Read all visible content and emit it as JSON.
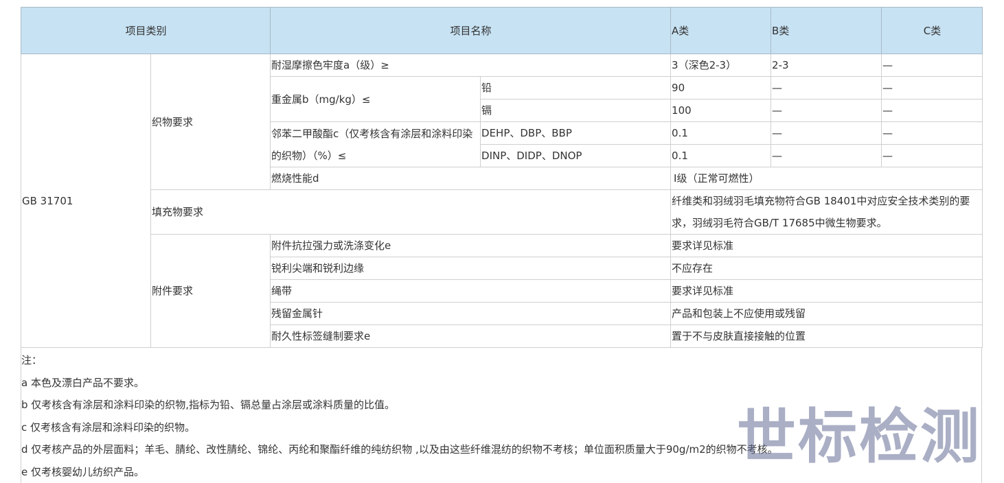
{
  "header": {
    "category": "项目类别",
    "name": "项目名称",
    "class_a": "A类",
    "class_b": "B类",
    "class_c": "C类"
  },
  "standard": "GB 31701",
  "fabric": {
    "label": "织物要求",
    "rub_fastness": {
      "name": "耐湿摩擦色牢度a（级）≥",
      "a": "3（深色2-3）",
      "b": "2-3",
      "c": "—"
    },
    "heavy_metal": {
      "name": "重金属b（mg/kg）≤",
      "lead": {
        "sub": "铅",
        "a": "90",
        "b": "—",
        "c": "—"
      },
      "cadmium": {
        "sub": "镉",
        "a": "100",
        "b": "—",
        "c": "—"
      }
    },
    "phthalates": {
      "name": "邻苯二甲酸酯c（仅考核含有涂层和涂料印染的织物）（%）≤",
      "dehp": {
        "sub": "DEHP、DBP、BBP",
        "a": "0.1",
        "b": "—",
        "c": "—"
      },
      "dinp": {
        "sub": "DINP、DIDP、DNOP",
        "a": "0.1",
        "b": "—",
        "c": "—"
      }
    },
    "flammability": {
      "name": "燃烧性能d",
      "value": "Ⅰ级（正常可燃性）"
    }
  },
  "filling": {
    "label": "填充物要求",
    "value": "纤维类和羽绒羽毛填充物符合GB 18401中对应安全技术类别的要求，羽绒羽毛符合GB/T 17685中微生物要求。"
  },
  "accessories": {
    "label": "附件要求",
    "rows": [
      {
        "name": "附件抗拉强力或洗涤变化e",
        "value": "要求详见标准"
      },
      {
        "name": "锐利尖端和锐利边缘",
        "value": "不应存在"
      },
      {
        "name": "绳带",
        "value": "要求详见标准"
      },
      {
        "name": "残留金属针",
        "value": "产品和包装上不应使用或残留"
      },
      {
        "name": "耐久性标签缝制要求e",
        "value": "置于不与皮肤直接接触的位置"
      }
    ]
  },
  "notes": [
    "注：",
    "a 本色及漂白产品不要求。",
    "b 仅考核含有涂层和涂料印染的织物,指标为铅、镉总量占涂层或涂料质量的比值。",
    "c 仅考核含有涂层和涂料印染的织物。",
    "d 仅考核产品的外层面料；羊毛、腈纶、改性腈纶、锦纶、丙纶和聚酯纤维的纯纺织物 ,以及由这些纤维混纺的织物不考核；单位面积质量大于90g/m2的织物不考核。",
    "e 仅考核婴幼儿纺织产品。"
  ],
  "watermark": "世标检测"
}
